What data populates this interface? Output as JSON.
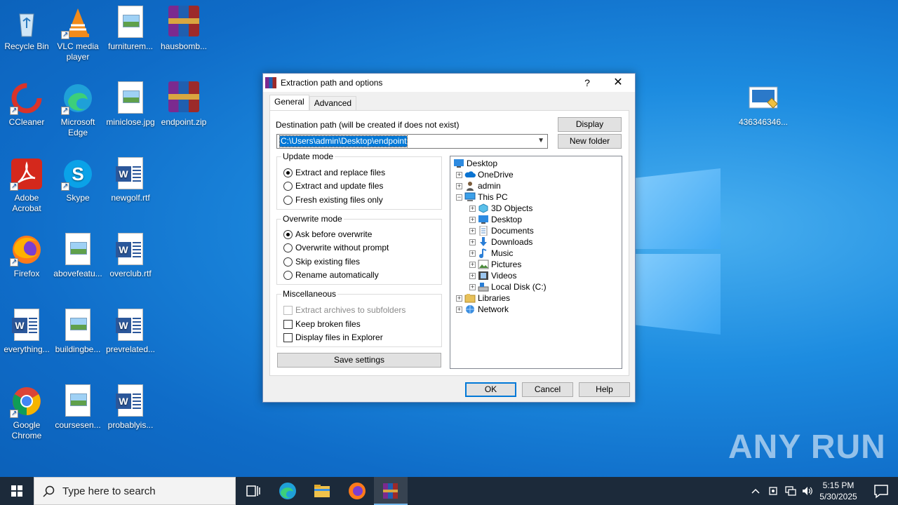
{
  "desktop": {
    "icons": [
      {
        "label": "Recycle Bin",
        "icon": "recycle-bin-icon"
      },
      {
        "label": "VLC media player",
        "icon": "vlc-icon"
      },
      {
        "label": "furniturem...",
        "icon": "image-file-icon"
      },
      {
        "label": "hausbomb...",
        "icon": "winrar-archive-icon"
      },
      {
        "label": "CCleaner",
        "icon": "ccleaner-icon"
      },
      {
        "label": "Microsoft Edge",
        "icon": "edge-icon"
      },
      {
        "label": "miniclose.jpg",
        "icon": "image-file-icon"
      },
      {
        "label": "endpoint.zip",
        "icon": "winrar-archive-icon"
      },
      {
        "label": "Adobe Acrobat",
        "icon": "acrobat-icon"
      },
      {
        "label": "Skype",
        "icon": "skype-icon"
      },
      {
        "label": "newgolf.rtf",
        "icon": "word-doc-icon"
      },
      {
        "label": "Firefox",
        "icon": "firefox-icon"
      },
      {
        "label": "abovefeatu...",
        "icon": "image-file-icon"
      },
      {
        "label": "overclub.rtf",
        "icon": "word-doc-icon"
      },
      {
        "label": "everything...",
        "icon": "word-doc-icon"
      },
      {
        "label": "buildingbe...",
        "icon": "image-file-icon"
      },
      {
        "label": "prevrelated...",
        "icon": "word-doc-icon"
      },
      {
        "label": "Google Chrome",
        "icon": "chrome-icon"
      },
      {
        "label": "coursesen...",
        "icon": "image-file-icon"
      },
      {
        "label": "probablyis...",
        "icon": "word-doc-icon"
      },
      {
        "label": "436346346...",
        "icon": "installer-icon"
      }
    ]
  },
  "dialog": {
    "title": "Extraction path and options",
    "help_glyph": "?",
    "close_glyph": "✕",
    "tabs": [
      "General",
      "Advanced"
    ],
    "dest_label": "Destination path (will be created if does not exist)",
    "dest_value": "C:\\Users\\admin\\Desktop\\endpoint",
    "display_button": "Display",
    "new_folder_button": "New folder",
    "update_mode": {
      "title": "Update mode",
      "options": [
        "Extract and replace files",
        "Extract and update files",
        "Fresh existing files only"
      ],
      "selected": "Extract and replace files"
    },
    "overwrite_mode": {
      "title": "Overwrite mode",
      "options": [
        "Ask before overwrite",
        "Overwrite without prompt",
        "Skip existing files",
        "Rename automatically"
      ],
      "selected": "Ask before overwrite"
    },
    "misc": {
      "title": "Miscellaneous",
      "options": [
        "Extract archives to subfolders",
        "Keep broken files",
        "Display files in Explorer"
      ]
    },
    "save_settings": "Save settings",
    "tree": [
      "Desktop",
      "OneDrive",
      "admin",
      "This PC",
      "3D Objects",
      "Desktop",
      "Documents",
      "Downloads",
      "Music",
      "Pictures",
      "Videos",
      "Local Disk (C:)",
      "Libraries",
      "Network"
    ],
    "ok": "OK",
    "cancel": "Cancel",
    "help": "Help"
  },
  "taskbar": {
    "search_placeholder": "Type here to search",
    "time": "5:15 PM",
    "date": "5/30/2025"
  },
  "watermark": "ANY RUN",
  "colors": {
    "accent": "#0078d7",
    "taskbar": "#1c2a3a",
    "desktop": "#0f6cc8"
  }
}
